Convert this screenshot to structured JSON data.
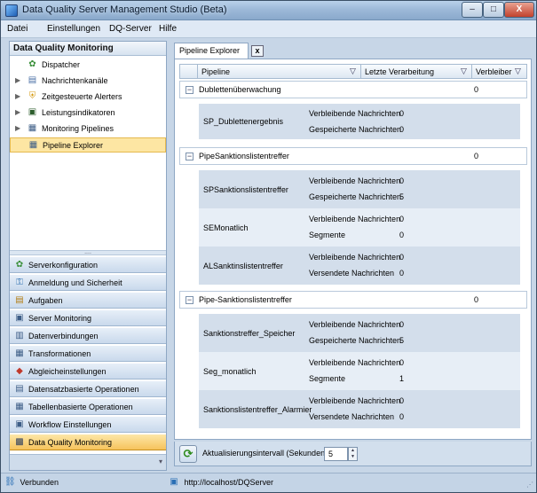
{
  "window": {
    "title": "Data Quality Server Management Studio (Beta)",
    "controls": {
      "minimize": "–",
      "maximize": "□",
      "close": "X"
    }
  },
  "menu": [
    "Datei",
    "Einstellungen",
    "DQ-Server",
    "Hilfe"
  ],
  "nav": {
    "header": "Data Quality Monitoring",
    "tree": [
      {
        "label": "Dispatcher",
        "icon": "dispatcher-icon",
        "expandable": false
      },
      {
        "label": "Nachrichtenkanäle",
        "icon": "channel-icon",
        "expandable": true
      },
      {
        "label": "Zeitgesteuerte Alerters",
        "icon": "shield-icon",
        "expandable": true
      },
      {
        "label": "Leistungsindikatoren",
        "icon": "monitor-icon",
        "expandable": true
      },
      {
        "label": "Monitoring Pipelines",
        "icon": "pipeline-icon",
        "expandable": true
      },
      {
        "label": "Pipeline Explorer",
        "icon": "explorer-icon",
        "expandable": false,
        "selected": true
      }
    ],
    "buttons": [
      "Serverkonfiguration",
      "Anmeldung und Sicherheit",
      "Aufgaben",
      "Server Monitoring",
      "Datenverbindungen",
      "Transformationen",
      "Abgleicheinstellungen",
      "Datensatzbasierte Operationen",
      "Tabellenbasierte Operationen",
      "Workflow Einstellungen",
      "Data Quality Monitoring"
    ],
    "splitter_dots": "....",
    "footer_chevron": "▾"
  },
  "tab": {
    "label": "Pipeline Explorer",
    "close": "x"
  },
  "grid": {
    "columns": [
      "Pipeline",
      "Letzte Verarbeitung",
      "Verbleiber"
    ],
    "groups": [
      {
        "name": "Dublettenüberwachung",
        "count": "0",
        "toggle": "−",
        "items": [
          {
            "name": "SP_Dublettenergebnis",
            "rows": [
              {
                "label": "Verbleibende Nachrichten",
                "value": "0"
              },
              {
                "label": "Gespeicherte Nachrichten",
                "value": "0"
              }
            ]
          }
        ]
      },
      {
        "name": "PipeSanktionslistentreffer",
        "count": "0",
        "toggle": "−",
        "items": [
          {
            "name": "SPSanktionslistentreffer",
            "rows": [
              {
                "label": "Verbleibende Nachrichten",
                "value": "0"
              },
              {
                "label": "Gespeicherte Nachrichten",
                "value": "5"
              }
            ]
          },
          {
            "name": "SEMonatlich",
            "rows": [
              {
                "label": "Verbleibende Nachrichten",
                "value": "0"
              },
              {
                "label": "Segmente",
                "value": "0"
              }
            ]
          },
          {
            "name": "ALSanktinslistentreffer",
            "rows": [
              {
                "label": "Verbleibende Nachrichten",
                "value": "0"
              },
              {
                "label": "Versendete Nachrichten",
                "value": "0"
              }
            ]
          }
        ]
      },
      {
        "name": "Pipe-Sanktionslistentreffer",
        "count": "0",
        "toggle": "−",
        "items": [
          {
            "name": "Sanktionstreffer_Speicher",
            "rows": [
              {
                "label": "Verbleibende Nachrichten",
                "value": "0"
              },
              {
                "label": "Gespeicherte Nachrichten",
                "value": "5"
              }
            ]
          },
          {
            "name": "Seg_monatlich",
            "rows": [
              {
                "label": "Verbleibende Nachrichten",
                "value": "0"
              },
              {
                "label": "Segmente",
                "value": "1"
              }
            ]
          },
          {
            "name": "Sanktionslistentreffer_Alarmier",
            "rows": [
              {
                "label": "Verbleibende Nachrichten",
                "value": "0"
              },
              {
                "label": "Versendete Nachrichten",
                "value": "0"
              }
            ]
          }
        ]
      }
    ]
  },
  "refresh": {
    "label": "Aktualisierungsintervall (Sekunden):",
    "value": "5",
    "icon": "refresh-icon"
  },
  "status": {
    "left": "Verbunden",
    "url": "http://localhost/DQServer"
  }
}
